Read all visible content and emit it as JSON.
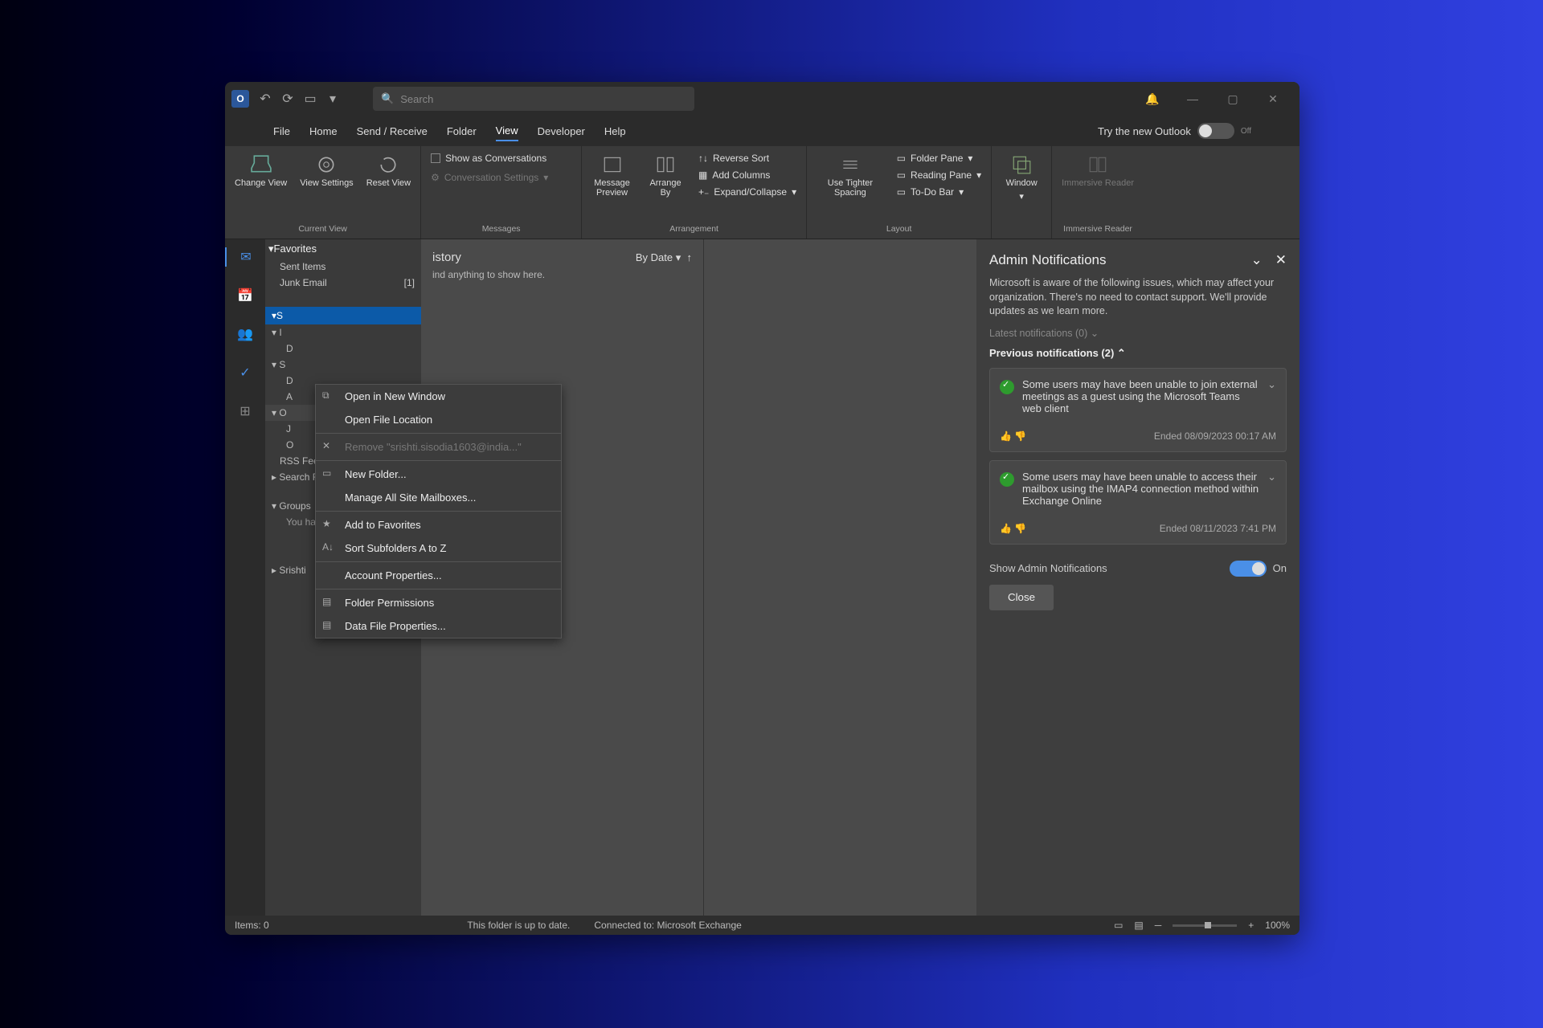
{
  "titlebar": {
    "logo_letter": "O",
    "search_placeholder": "Search"
  },
  "menubar": {
    "tabs": [
      "File",
      "Home",
      "Send / Receive",
      "Folder",
      "View",
      "Developer",
      "Help"
    ],
    "active_index": 4,
    "try_new": "Try the new Outlook",
    "try_toggle_label": "Off"
  },
  "ribbon": {
    "groups": {
      "current_view": {
        "label": "Current View",
        "change_view": "Change View",
        "view_settings": "View Settings",
        "reset_view": "Reset View"
      },
      "messages": {
        "label": "Messages",
        "show_conv": "Show as Conversations",
        "conv_settings": "Conversation Settings"
      },
      "arrangement": {
        "label": "Arrangement",
        "preview": "Message Preview",
        "arrange_by": "Arrange By",
        "reverse_sort": "Reverse Sort",
        "add_columns": "Add Columns",
        "expand_collapse": "Expand/Collapse"
      },
      "layout": {
        "label": "Layout",
        "tighter": "Use Tighter Spacing",
        "folder_pane": "Folder Pane",
        "reading_pane": "Reading Pane",
        "todo_bar": "To-Do Bar"
      },
      "window": {
        "label": "Window",
        "window": "Window"
      },
      "immersive": {
        "label": "Immersive Reader",
        "reader": "Immersive Reader"
      }
    }
  },
  "foldertree": {
    "favorites": "Favorites",
    "sent_items": "Sent Items",
    "junk": {
      "name": "Junk Email",
      "count": "[1]"
    },
    "sel_account": "S",
    "inbox_frag": "I",
    "d1": "D",
    "s2": "S",
    "d2": "D",
    "a": "A",
    "o": "O",
    "jfrag": "J",
    "ofrag": "O",
    "rss": "RSS Feeds",
    "search_folders": "Search Folders",
    "groups": "Groups",
    "not_joined": "You have not joined...",
    "srishti": "Srishti"
  },
  "msglist": {
    "folder_name_fragment": "istory",
    "sort": "By Date",
    "empty": "ind anything to show here."
  },
  "admin": {
    "title": "Admin Notifications",
    "intro": "Microsoft is aware of the following issues, which may affect your organization. There's no need to contact support. We'll provide updates as we learn more.",
    "latest": "Latest notifications (0)",
    "previous": "Previous notifications (2)",
    "cards": [
      {
        "text": "Some users may have been unable to join external meetings as a guest using the Microsoft Teams web client",
        "ended": "Ended 08/09/2023 00:17 AM"
      },
      {
        "text": "Some users may have been unable to access their mailbox using the IMAP4 connection method within Exchange Online",
        "ended": "Ended 08/11/2023 7:41 PM"
      }
    ],
    "show_label": "Show Admin Notifications",
    "show_state": "On",
    "close": "Close"
  },
  "contextmenu": {
    "items": [
      {
        "label": "Open in New Window",
        "icon": "⧉"
      },
      {
        "label": "Open File Location"
      },
      {
        "sep": true
      },
      {
        "label": "Remove \"srishti.sisodia1603@india...\"",
        "disabled": true,
        "icon": "✕"
      },
      {
        "sep": true
      },
      {
        "label": "New Folder...",
        "icon": "▭"
      },
      {
        "label": "Manage All Site Mailboxes..."
      },
      {
        "sep": true
      },
      {
        "label": "Add to Favorites",
        "icon": "★"
      },
      {
        "label": "Sort Subfolders A to Z",
        "icon": "A↓"
      },
      {
        "sep": true
      },
      {
        "label": "Account Properties..."
      },
      {
        "sep": true
      },
      {
        "label": "Folder Permissions",
        "icon": "▤"
      },
      {
        "label": "Data File Properties...",
        "icon": "▤"
      }
    ]
  },
  "statusbar": {
    "items": "Items: 0",
    "status": "This folder is up to date.",
    "connected": "Connected to: Microsoft Exchange",
    "zoom": "100%"
  }
}
